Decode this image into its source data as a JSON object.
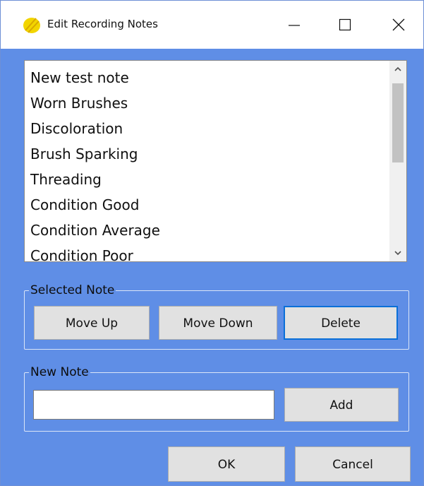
{
  "window": {
    "title": "Edit Recording Notes",
    "icon": "pencil-icon",
    "controls": [
      "minimize-icon",
      "maximize-icon",
      "close-icon"
    ]
  },
  "notes_list": {
    "items": [
      "New test note",
      "Worn Brushes",
      "Discoloration",
      "Brush Sparking",
      "Threading",
      "Condition Good",
      "Condition Average",
      "Condition Poor"
    ]
  },
  "selected_note": {
    "legend": "Selected Note",
    "move_up_label": "Move Up",
    "move_down_label": "Move Down",
    "delete_label": "Delete"
  },
  "new_note": {
    "legend": "New Note",
    "input_value": "",
    "add_label": "Add"
  },
  "footer": {
    "ok_label": "OK",
    "cancel_label": "Cancel"
  },
  "colors": {
    "window_background": "#5f8ee6",
    "title_bar": "#ffffff",
    "button_face": "#e1e1e1",
    "default_button_border": "#0b6fd8",
    "icon_yellow": "#f2d500"
  }
}
